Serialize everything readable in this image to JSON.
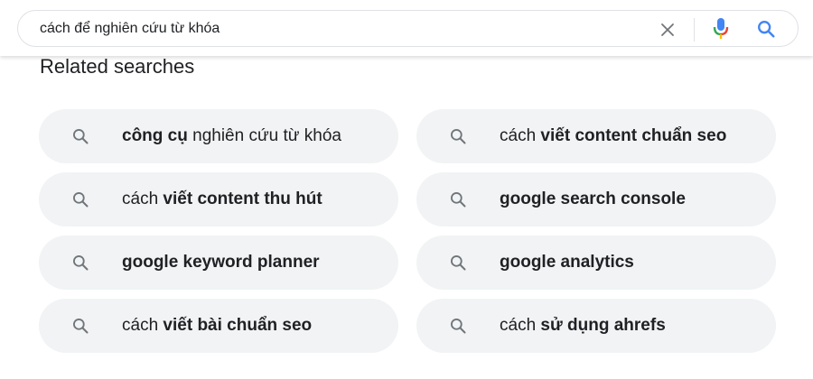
{
  "search": {
    "value": "cách để nghiên cứu từ khóa",
    "clear_icon": "close-icon",
    "mic_icon": "microphone-icon",
    "search_icon": "search-icon"
  },
  "related": {
    "title": "Related searches",
    "items": [
      {
        "plain1": "",
        "bold1": "công cụ",
        "plain2": " nghiên cứu từ khóa",
        "bold2": ""
      },
      {
        "plain1": "cách ",
        "bold1": "viết content chuẩn seo",
        "plain2": "",
        "bold2": ""
      },
      {
        "plain1": "cách ",
        "bold1": "viết content thu hút",
        "plain2": "",
        "bold2": ""
      },
      {
        "plain1": "",
        "bold1": "google search console",
        "plain2": "",
        "bold2": ""
      },
      {
        "plain1": "",
        "bold1": "google keyword planner",
        "plain2": "",
        "bold2": ""
      },
      {
        "plain1": "",
        "bold1": "google analytics",
        "plain2": "",
        "bold2": ""
      },
      {
        "plain1": "cách ",
        "bold1": "viết bài chuẩn seo",
        "plain2": "",
        "bold2": ""
      },
      {
        "plain1": "cách ",
        "bold1": "sử dụng ahrefs",
        "plain2": "",
        "bold2": ""
      }
    ]
  },
  "colors": {
    "chip_bg": "#f1f3f4",
    "text": "#202124",
    "icon_gray": "#70757a",
    "google_blue": "#4285f4",
    "google_red": "#ea4335",
    "google_yellow": "#fbbc04",
    "google_green": "#34a853"
  }
}
